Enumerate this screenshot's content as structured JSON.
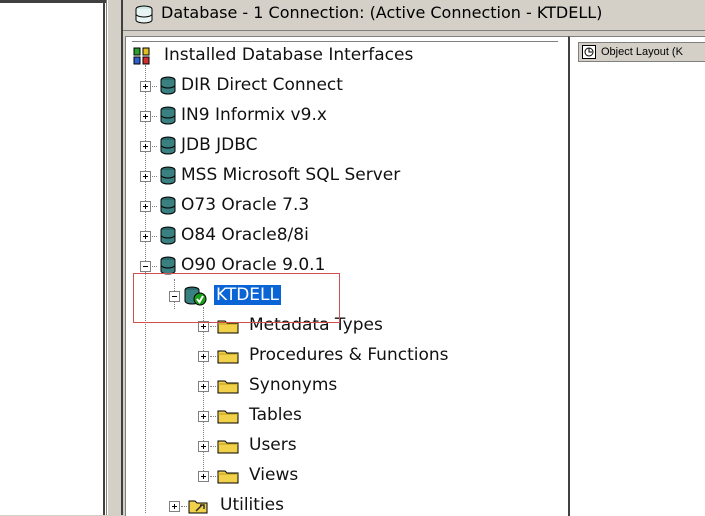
{
  "title": "Database - 1 Connection: (Active Connection - KTDELL)",
  "right_tab_label": "Object Layout (K",
  "tree": {
    "root_label": "Installed Database Interfaces",
    "interfaces": [
      {
        "label": "DIR Direct Connect"
      },
      {
        "label": "IN9 Informix v9.x"
      },
      {
        "label": "JDB JDBC"
      },
      {
        "label": "MSS Microsoft SQL Server"
      },
      {
        "label": "O73 Oracle 7.3"
      },
      {
        "label": "O84 Oracle8/8i"
      },
      {
        "label": "O90 Oracle 9.0.1"
      }
    ],
    "connection": {
      "label": "KTDELL"
    },
    "folders": [
      {
        "label": "Metadata Types"
      },
      {
        "label": "Procedures & Functions"
      },
      {
        "label": "Synonyms"
      },
      {
        "label": "Tables"
      },
      {
        "label": "Users"
      },
      {
        "label": "Views"
      }
    ],
    "utilities_label": "Utilities"
  },
  "colors": {
    "selection": "#0a64d6",
    "highlight_box": "#d05050",
    "folder": "#f2d14a"
  }
}
